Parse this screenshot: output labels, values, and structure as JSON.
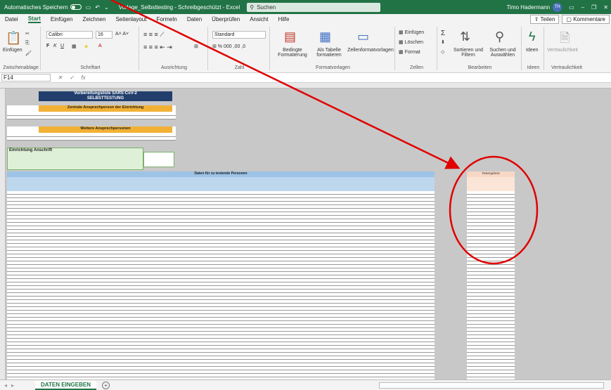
{
  "titlebar": {
    "autosave": "Automatisches Speichern",
    "autosave_state": "off",
    "doc_title": "Vorlage_Selbsttesting - Schreibgeschützt - Excel",
    "search_placeholder": "Suchen",
    "user_name": "Timo Hadermann",
    "user_initials": "TH"
  },
  "menu": {
    "tabs": [
      "Datei",
      "Start",
      "Einfügen",
      "Zeichnen",
      "Seitenlayout",
      "Formeln",
      "Daten",
      "Überprüfen",
      "Ansicht",
      "Hilfe"
    ],
    "share": "Teilen",
    "comments": "Kommentare"
  },
  "ribbon": {
    "clipboard": {
      "paste": "Einfügen",
      "label": "Zwischenablage"
    },
    "font": {
      "name": "Calibri",
      "size": "16",
      "label": "Schriftart"
    },
    "alignment": {
      "label": "Ausrichtung"
    },
    "number": {
      "format": "Standard",
      "label": "Zahl"
    },
    "styles": {
      "conditional": "Bedingte Formatierung",
      "as_table": "Als Tabelle formatieren",
      "cell_styles": "Zellenformatvorlagen",
      "label": "Formatvorlagen"
    },
    "cells": {
      "insert": "Einfügen",
      "delete": "Löschen",
      "format": "Format",
      "label": "Zellen"
    },
    "editing": {
      "sort": "Sortieren und Filtern",
      "find": "Suchen und Auswählen",
      "label": "Bearbeiten"
    },
    "ideas": {
      "btn": "Ideen",
      "label": "Ideen"
    },
    "sensitivity": {
      "btn": "Vertraulichkeit",
      "label": "Vertraulichkeit"
    }
  },
  "formula_bar": {
    "name_box": "F14",
    "formula": ""
  },
  "sheet": {
    "main_title": "Vorbereitungsliste SARS-CoV-2",
    "main_subtitle": "SELBSTTESTUNG",
    "block1_title": "Zentrale Ansprechperson der Einrichtung",
    "block2_title": "Weitere Ansprechpersonen",
    "green_title": "Einrichtung Anschrift",
    "blue_title": "Daten für zu testende Personen",
    "right_title": "Testergebnis"
  },
  "tabs": {
    "sheet_name": "DATEN EINGEBEN",
    "add": "+"
  },
  "colors": {
    "excel_green": "#217346",
    "annotation_red": "#e00000"
  }
}
